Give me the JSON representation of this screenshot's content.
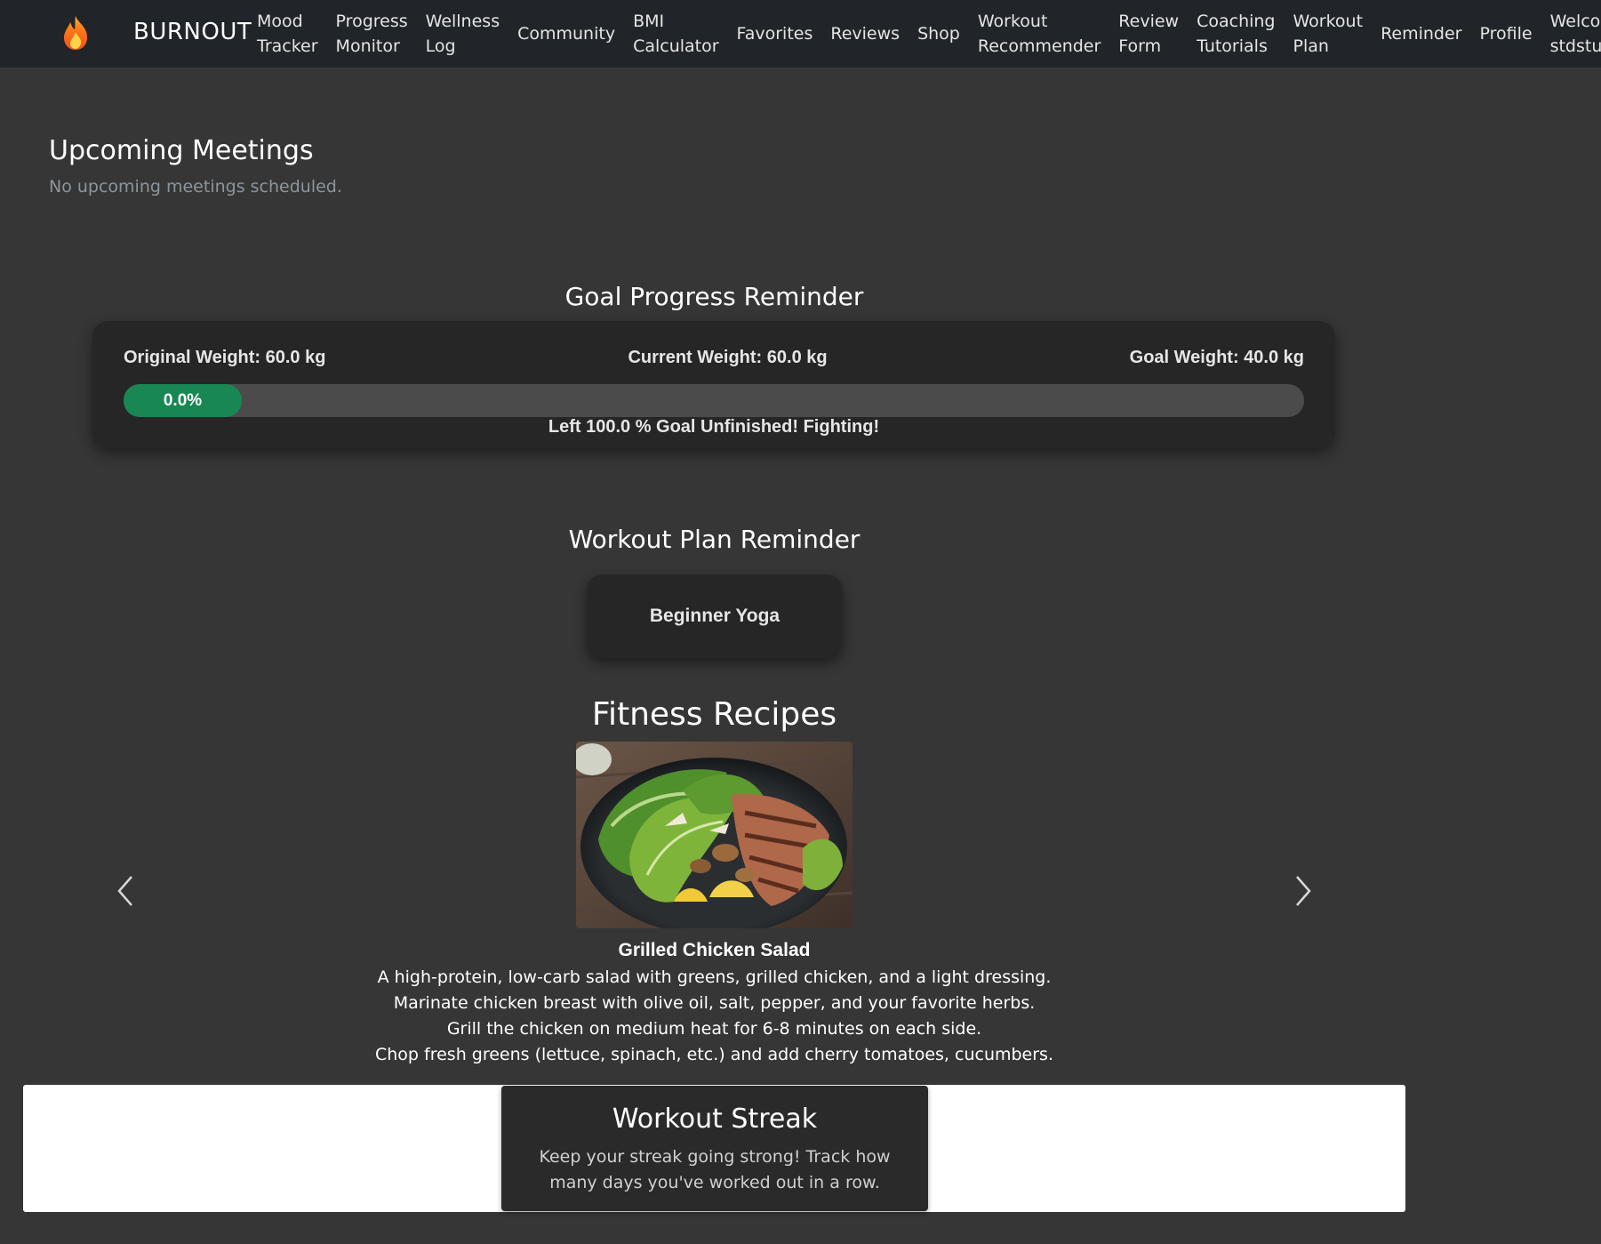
{
  "nav": {
    "brand": "BURNOUT",
    "logo_icon": "flame-icon",
    "items": [
      {
        "label": "Mood\nTracker"
      },
      {
        "label": "Progress\nMonitor"
      },
      {
        "label": "Wellness\nLog"
      },
      {
        "label": "Community"
      },
      {
        "label": "BMI\nCalculator"
      },
      {
        "label": "Favorites"
      },
      {
        "label": "Reviews"
      },
      {
        "label": "Shop"
      },
      {
        "label": "Workout\nRecommender"
      },
      {
        "label": "Review\nForm"
      },
      {
        "label": "Coaching\nTutorials"
      },
      {
        "label": "Workout\nPlan"
      },
      {
        "label": "Reminder"
      },
      {
        "label": "Profile"
      }
    ],
    "welcome": "Welcome,\nstdstudent"
  },
  "meetings": {
    "title": "Upcoming Meetings",
    "empty_text": "No upcoming meetings scheduled."
  },
  "goal": {
    "title": "Goal Progress Reminder",
    "original_weight": "Original Weight: 60.0 kg",
    "current_weight": "Current Weight: 60.0 kg",
    "goal_weight": "Goal Weight: 40.0 kg",
    "progress_label": "0.0%",
    "progress_fraction": 0.0,
    "message": "Left 100.0 % Goal Unfinished! Fighting!",
    "accent_color": "#198754"
  },
  "workout_plan": {
    "title": "Workout Plan Reminder",
    "plan_name": "Beginner Yoga"
  },
  "recipes": {
    "title": "Fitness Recipes",
    "prev_icon": "chevron-left-icon",
    "next_icon": "chevron-right-icon",
    "current": {
      "name": "Grilled Chicken Salad",
      "image_alt": "grilled-chicken-salad-photo",
      "lines": [
        "A high-protein, low-carb salad with greens, grilled chicken, and a light dressing.",
        "Marinate chicken breast with olive oil, salt, pepper, and your favorite herbs.",
        "Grill the chicken on medium heat for 6-8 minutes on each side.",
        "Chop fresh greens (lettuce, spinach, etc.) and add cherry tomatoes, cucumbers."
      ]
    }
  },
  "streak": {
    "title": "Workout Streak",
    "description": "Keep your streak going strong! Track how many days you've worked out in a row."
  }
}
